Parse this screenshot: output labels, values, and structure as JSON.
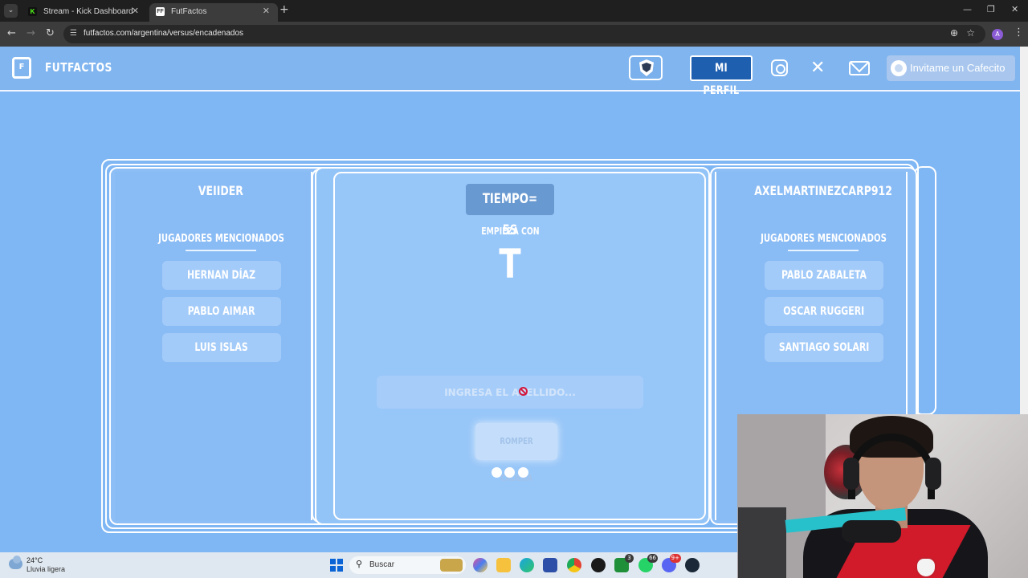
{
  "browser": {
    "tabs": [
      {
        "title": "Stream - Kick Dashboard",
        "favicon": "K"
      },
      {
        "title": "FutFactos",
        "favicon": "FF"
      }
    ],
    "url": "futfactos.com/argentina/versus/encadenados"
  },
  "header": {
    "brand": "FUTFACTOS",
    "profile_button": "MI PERFIL",
    "coffee_button": "Invitame un Cafecito"
  },
  "game": {
    "left_player": {
      "name": "VEIIDER",
      "mentioned_title": "JUGADORES MENCIONADOS",
      "players": [
        "HERNAN DÍAZ",
        "PABLO AIMAR",
        "LUIS ISLAS"
      ]
    },
    "right_player": {
      "name": "AXELMARTINEZCARP912",
      "mentioned_title": "JUGADORES MENCIONADOS",
      "players": [
        "PABLO ZABALETA",
        "OSCAR RUGGERI",
        "SANTIAGO SOLARI"
      ]
    },
    "center": {
      "timer": "TIEMPO= 5S",
      "starts_with_label": "EMPIEZA CON",
      "letter": "T",
      "input_placeholder": "INGRESA EL APELLIDO...",
      "break_chain_button": "ROMPER CADENA"
    }
  },
  "taskbar": {
    "temperature": "24°C",
    "weather": "Lluvia ligera",
    "search_label": "Buscar",
    "badges": {
      "xbox": "3",
      "whatsapp": "66",
      "discord": "9+"
    }
  },
  "colors": {
    "page_bg": "#7fb6f4",
    "panel_bg": "#8fc0f7",
    "accent_dark": "#6899d0"
  }
}
